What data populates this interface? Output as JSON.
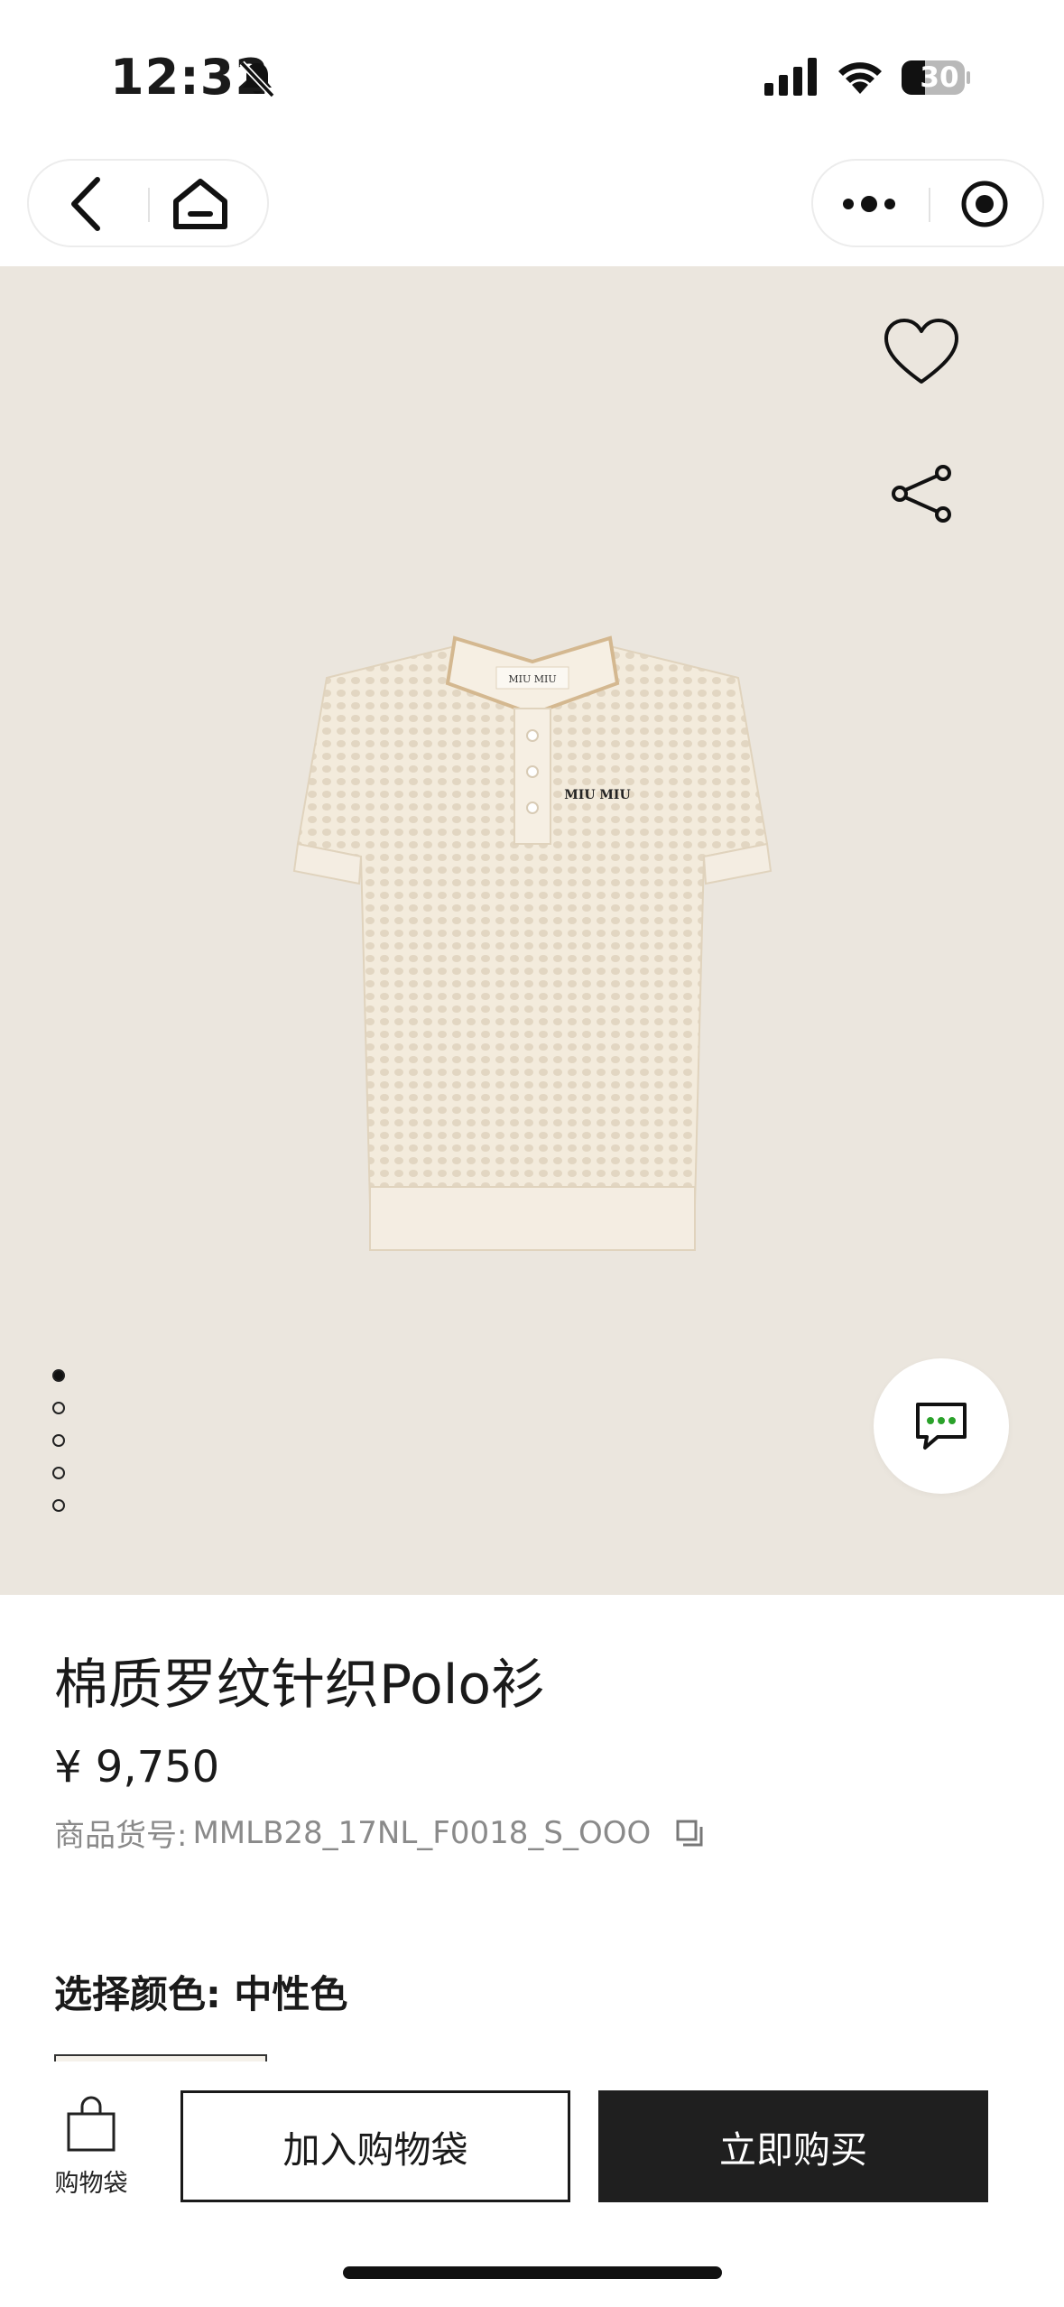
{
  "status_bar": {
    "time": "12:32",
    "battery": "30"
  },
  "product": {
    "title": "棉质罗纹针织Polo衫",
    "price": "¥ 9,750",
    "sku_label": "商品货号:",
    "sku_value": "MMLB28_17NL_F0018_S_OOO",
    "color_label": "选择颜色: 中性色",
    "logo_text": "MIU MIU"
  },
  "gallery": {
    "image_count": 5,
    "active_index": 0
  },
  "bottom_bar": {
    "bag_label": "购物袋",
    "add_to_bag": "加入购物袋",
    "buy_now": "立即购买"
  },
  "colors": {
    "hero_bg": "#ebe6de",
    "buy_button": "#1f1f1f",
    "chat_dots": "#2aa12a"
  }
}
